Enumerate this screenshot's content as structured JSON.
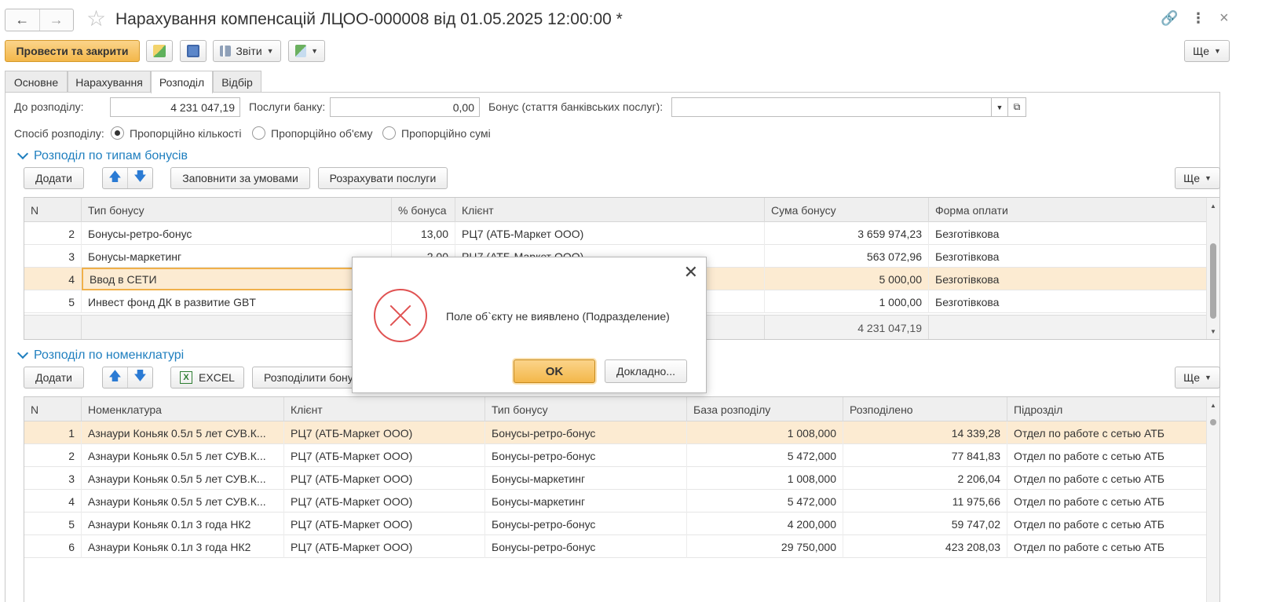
{
  "window": {
    "title": "Нарахування компенсацій ЛЦОО-000008 від 01.05.2025 12:00:00 *",
    "back_icon": "←",
    "forward_icon": "→",
    "star_icon": "☆",
    "link_icon": "🔗",
    "menu_icon": "⋮",
    "close_icon": "×"
  },
  "toolbar": {
    "post_close": "Провести та закрити",
    "reports": "Звіти",
    "more": "Ще"
  },
  "tabs": [
    {
      "label": "Основне"
    },
    {
      "label": "Нарахування"
    },
    {
      "label": "Розподіл"
    },
    {
      "label": "Відбір"
    }
  ],
  "form": {
    "to_distribute_label": "До розподілу:",
    "to_distribute_value": "4 231 047,19",
    "bank_services_label": "Послуги банку:",
    "bank_services_value": "0,00",
    "bonus_label": "Бонус (стаття банківських послуг):",
    "bonus_value": "",
    "method_label": "Спосіб розподілу:",
    "method_options": [
      "Пропорційно кількості",
      "Пропорційно об'єму",
      "Пропорційно сумі"
    ],
    "method_selected": 0
  },
  "section1": {
    "title": "Розподіл по типам бонусів",
    "add": "Додати",
    "fill": "Заповнити за умовами",
    "calc": "Розрахувати послуги",
    "more": "Ще",
    "columns": [
      "N",
      "Тип бонусу",
      "% бонуса",
      "Клієнт",
      "Сума бонусу",
      "Форма оплати"
    ],
    "rows": [
      {
        "n": "2",
        "type": "Бонусы-ретро-бонус",
        "pct": "13,00",
        "client": "РЦ7 (АТБ-Маркет ООО)",
        "sum": "3 659 974,23",
        "pay": "Безготівкова"
      },
      {
        "n": "3",
        "type": "Бонусы-маркетинг",
        "pct": "2,00",
        "client": "РЦ7 (АТБ-Маркет ООО)",
        "sum": "563 072,96",
        "pay": "Безготівкова"
      },
      {
        "n": "4",
        "type": "Ввод в СЕТИ",
        "pct": "",
        "client": "",
        "sum": "5 000,00",
        "pay": "Безготівкова"
      },
      {
        "n": "5",
        "type": "Инвест фонд ДК в развитие GBT",
        "pct": "",
        "client": "",
        "sum": "1 000,00",
        "pay": "Безготівкова"
      }
    ],
    "total": "4 231 047,19"
  },
  "section2": {
    "title": "Розподіл по номенклатурі",
    "add": "Додати",
    "excel": "EXCEL",
    "distribute": "Розподілити бону",
    "more": "Ще",
    "columns": [
      "N",
      "Номенклатура",
      "Клієнт",
      "Тип бонусу",
      "База розподілу",
      "Розподілено",
      "Підрозділ"
    ],
    "rows": [
      {
        "n": "1",
        "item": "Азнаури Коньяк 0.5л 5 лет СУВ.К...",
        "client": "РЦ7 (АТБ-Маркет ООО)",
        "type": "Бонусы-ретро-бонус",
        "base": "1 008,000",
        "dist": "14 339,28",
        "dept": "Отдел по работе с сетью АТБ"
      },
      {
        "n": "2",
        "item": "Азнаури Коньяк 0.5л 5 лет СУВ.К...",
        "client": "РЦ7 (АТБ-Маркет ООО)",
        "type": "Бонусы-ретро-бонус",
        "base": "5 472,000",
        "dist": "77 841,83",
        "dept": "Отдел по работе с сетью АТБ"
      },
      {
        "n": "3",
        "item": "Азнаури Коньяк 0.5л 5 лет СУВ.К...",
        "client": "РЦ7 (АТБ-Маркет ООО)",
        "type": "Бонусы-маркетинг",
        "base": "1 008,000",
        "dist": "2 206,04",
        "dept": "Отдел по работе с сетью АТБ"
      },
      {
        "n": "4",
        "item": "Азнаури Коньяк 0.5л 5 лет СУВ.К...",
        "client": "РЦ7 (АТБ-Маркет ООО)",
        "type": "Бонусы-маркетинг",
        "base": "5 472,000",
        "dist": "11 975,66",
        "dept": "Отдел по работе с сетью АТБ"
      },
      {
        "n": "5",
        "item": "Азнаури Коньяк 0.1л 3 года НК2",
        "client": "РЦ7 (АТБ-Маркет ООО)",
        "type": "Бонусы-ретро-бонус",
        "base": "4 200,000",
        "dist": "59 747,02",
        "dept": "Отдел по работе с сетью АТБ"
      },
      {
        "n": "6",
        "item": "Азнаури Коньяк 0.1л 3 года НК2",
        "client": "РЦ7 (АТБ-Маркет ООО)",
        "type": "Бонусы-ретро-бонус",
        "base": "29 750,000",
        "dist": "423 208,03",
        "dept": "Отдел по работе с сетью АТБ"
      }
    ]
  },
  "dialog": {
    "message": "Поле об`єкту не виявлено (Подразделение)",
    "ok": "OK",
    "details": "Докладно..."
  },
  "colors": {
    "accent": "#1f7fbf",
    "primary_button": "#f3b74a",
    "selected_row": "#fcebd2",
    "error": "#e05252"
  }
}
